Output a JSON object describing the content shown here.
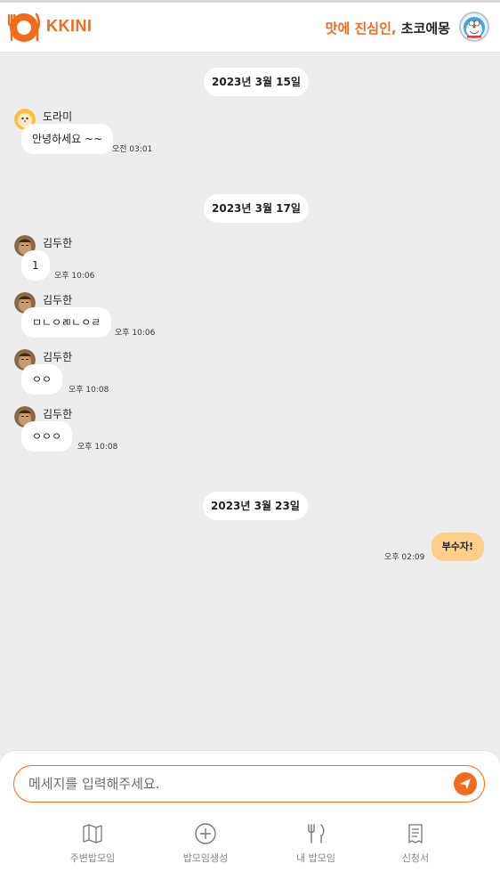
{
  "header": {
    "brand": "KKINI",
    "greeting_highlight": "맛에 진심인,",
    "greeting_name": " 초코에몽"
  },
  "chat": {
    "dates": [
      "2023년 3월 15일",
      "2023년 3월 17일",
      "2023년 3월 23일"
    ],
    "messages": [
      {
        "sender": "도라미",
        "text": "안녕하세요 ~~",
        "time": "오전 03:01"
      },
      {
        "sender": "김두한",
        "text": "1",
        "time": "오후 10:06"
      },
      {
        "sender": "김두한",
        "text": "ㅁㄴㅇㄻㄴㅇㄹ",
        "time": "오후 10:06"
      },
      {
        "sender": "김두한",
        "text": "ㅇㅇ",
        "time": "오후 10:08"
      },
      {
        "sender": "김두한",
        "text": "ㅇㅇㅇ",
        "time": "오후 10:08"
      }
    ],
    "my_message": {
      "text": "부수자!",
      "time": "오후 02:09"
    }
  },
  "input": {
    "placeholder": "메세지를 입력해주세요."
  },
  "nav": {
    "items": [
      {
        "label": "주변밥모임",
        "icon": "map-icon"
      },
      {
        "label": "밥모임생성",
        "icon": "plus-circle-icon"
      },
      {
        "label": "내 밥모임",
        "icon": "fork-knife-icon"
      },
      {
        "label": "신청서",
        "icon": "receipt-icon"
      }
    ]
  },
  "colors": {
    "accent": "#f26a1b",
    "my_bubble": "#fdd089",
    "background": "#ededed"
  }
}
